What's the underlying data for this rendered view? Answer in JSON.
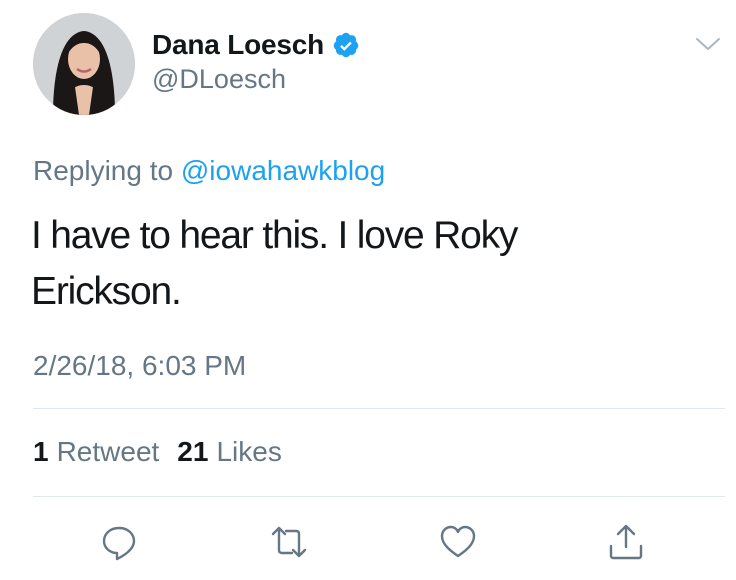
{
  "user": {
    "display_name": "Dana Loesch",
    "handle": "@DLoesch",
    "verified": true,
    "avatar_icon": "profile-photo"
  },
  "reply": {
    "prefix": "Replying to",
    "to_handle": "@iowahawkblog"
  },
  "tweet": {
    "text": "I have to hear this. I love Roky Erickson.",
    "timestamp": "2/26/18, 6:03 PM"
  },
  "stats": {
    "retweets_count": "1",
    "retweets_label": "Retweet",
    "likes_count": "21",
    "likes_label": "Likes"
  },
  "actions": {
    "reply_icon": "reply-icon",
    "retweet_icon": "retweet-icon",
    "like_icon": "heart-icon",
    "share_icon": "share-icon"
  },
  "colors": {
    "accent": "#1da1f2",
    "secondary_text": "#657786",
    "primary_text": "#14171a",
    "divider": "#e1e8ed"
  }
}
